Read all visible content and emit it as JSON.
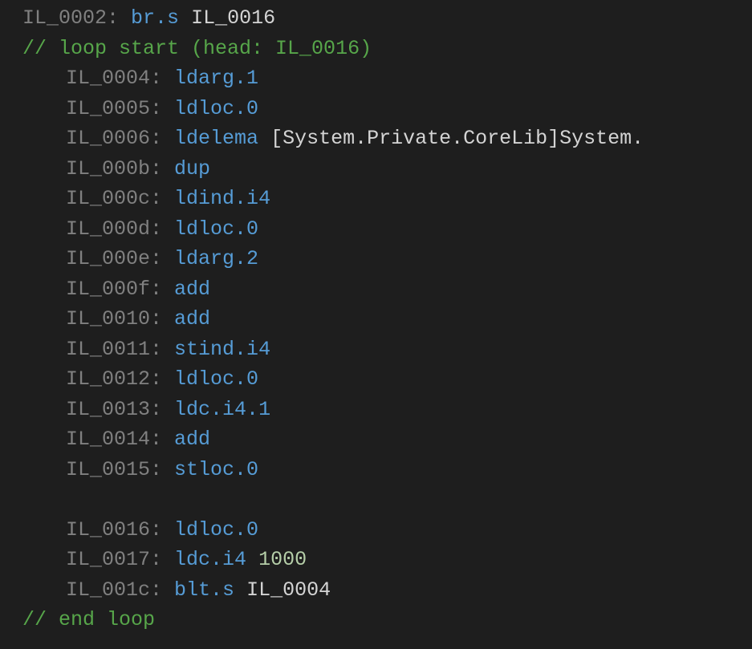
{
  "lines": [
    {
      "indent": 0,
      "kind": "instr",
      "label": "IL_0002",
      "opcode": "br.s",
      "arg": "IL_0016",
      "argClass": "arg"
    },
    {
      "indent": 0,
      "kind": "comment",
      "text": "// loop start (head: IL_0016)"
    },
    {
      "indent": 1,
      "kind": "instr",
      "label": "IL_0004",
      "opcode": "ldarg.1"
    },
    {
      "indent": 1,
      "kind": "instr",
      "label": "IL_0005",
      "opcode": "ldloc.0"
    },
    {
      "indent": 1,
      "kind": "instr",
      "label": "IL_0006",
      "opcode": "ldelema",
      "arg": "[System.Private.CoreLib]System.",
      "argClass": "type"
    },
    {
      "indent": 1,
      "kind": "instr",
      "label": "IL_000b",
      "opcode": "dup"
    },
    {
      "indent": 1,
      "kind": "instr",
      "label": "IL_000c",
      "opcode": "ldind.i4"
    },
    {
      "indent": 1,
      "kind": "instr",
      "label": "IL_000d",
      "opcode": "ldloc.0"
    },
    {
      "indent": 1,
      "kind": "instr",
      "label": "IL_000e",
      "opcode": "ldarg.2"
    },
    {
      "indent": 1,
      "kind": "instr",
      "label": "IL_000f",
      "opcode": "add"
    },
    {
      "indent": 1,
      "kind": "instr",
      "label": "IL_0010",
      "opcode": "add"
    },
    {
      "indent": 1,
      "kind": "instr",
      "label": "IL_0011",
      "opcode": "stind.i4"
    },
    {
      "indent": 1,
      "kind": "instr",
      "label": "IL_0012",
      "opcode": "ldloc.0"
    },
    {
      "indent": 1,
      "kind": "instr",
      "label": "IL_0013",
      "opcode": "ldc.i4.1"
    },
    {
      "indent": 1,
      "kind": "instr",
      "label": "IL_0014",
      "opcode": "add"
    },
    {
      "indent": 1,
      "kind": "instr",
      "label": "IL_0015",
      "opcode": "stloc.0"
    },
    {
      "indent": 1,
      "kind": "blank"
    },
    {
      "indent": 1,
      "kind": "instr",
      "label": "IL_0016",
      "opcode": "ldloc.0"
    },
    {
      "indent": 1,
      "kind": "instr",
      "label": "IL_0017",
      "opcode": "ldc.i4",
      "arg": "1000",
      "argClass": "num"
    },
    {
      "indent": 1,
      "kind": "instr",
      "label": "IL_001c",
      "opcode": "blt.s",
      "arg": "IL_0004",
      "argClass": "arg"
    },
    {
      "indent": 0,
      "kind": "comment",
      "text": "// end loop"
    }
  ]
}
